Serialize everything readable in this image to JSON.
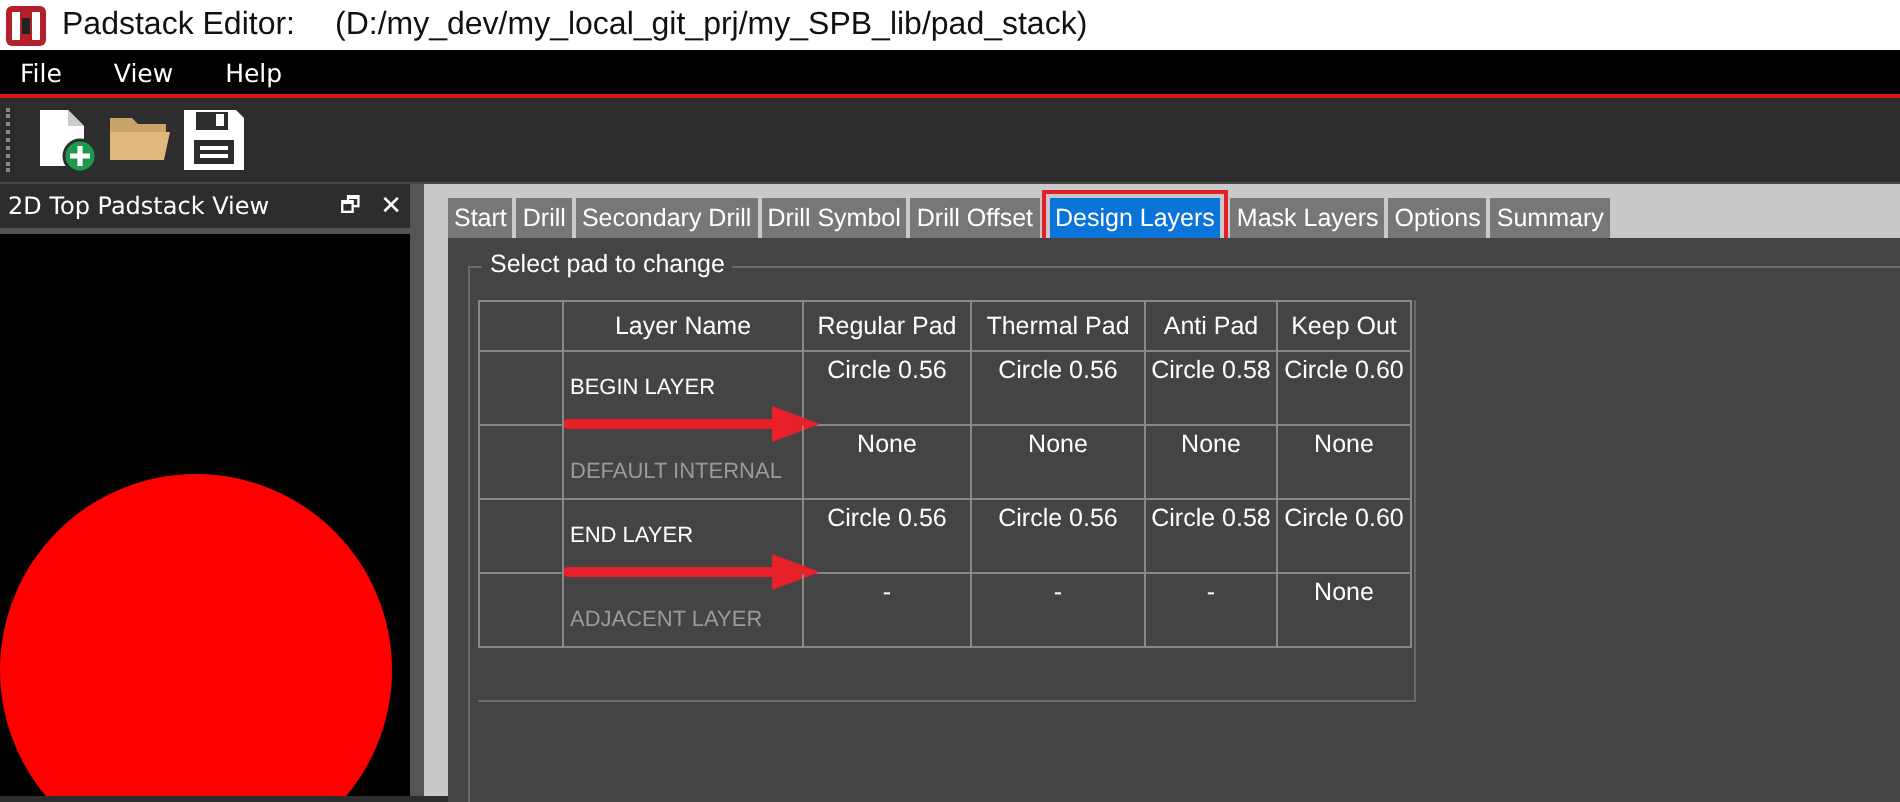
{
  "window": {
    "title": "Padstack Editor:",
    "path": "(D:/my_dev/my_local_git_prj/my_SPB_lib/pad_stack)"
  },
  "menu": [
    "File",
    "View",
    "Help"
  ],
  "toolbar": [
    {
      "kind": "new"
    },
    {
      "kind": "open"
    },
    {
      "kind": "save"
    }
  ],
  "side_panel": {
    "title": "2D Top Padstack View",
    "float_button": "🗗",
    "close_button": "✕"
  },
  "tabs": [
    {
      "label": "Start",
      "selected": false
    },
    {
      "label": "Drill",
      "selected": false
    },
    {
      "label": "Secondary Drill",
      "selected": false
    },
    {
      "label": "Drill Symbol",
      "selected": false
    },
    {
      "label": "Drill Offset",
      "selected": false
    },
    {
      "label": "Design Layers",
      "selected": true
    },
    {
      "label": "Mask Layers",
      "selected": false
    },
    {
      "label": "Options",
      "selected": false
    },
    {
      "label": "Summary",
      "selected": false
    }
  ],
  "group_title": "Select pad to change",
  "table": {
    "columns": [
      "Layer Name",
      "Regular Pad",
      "Thermal Pad",
      "Anti Pad",
      "Keep Out"
    ],
    "rows": [
      {
        "cells": [
          "BEGIN LAYER",
          "Circle 0.56",
          "Circle 0.56",
          "Circle 0.58",
          "Circle 0.60"
        ],
        "dimmed": false,
        "arrow": true
      },
      {
        "cells": [
          "DEFAULT INTERNAL",
          "None",
          "None",
          "None",
          "None"
        ],
        "dimmed": true,
        "arrow": false
      },
      {
        "cells": [
          "END LAYER",
          "Circle 0.56",
          "Circle 0.56",
          "Circle 0.58",
          "Circle 0.60"
        ],
        "dimmed": false,
        "arrow": true
      },
      {
        "cells": [
          "ADJACENT LAYER",
          "-",
          "-",
          "-",
          "None"
        ],
        "dimmed": true,
        "arrow": false
      }
    ]
  }
}
